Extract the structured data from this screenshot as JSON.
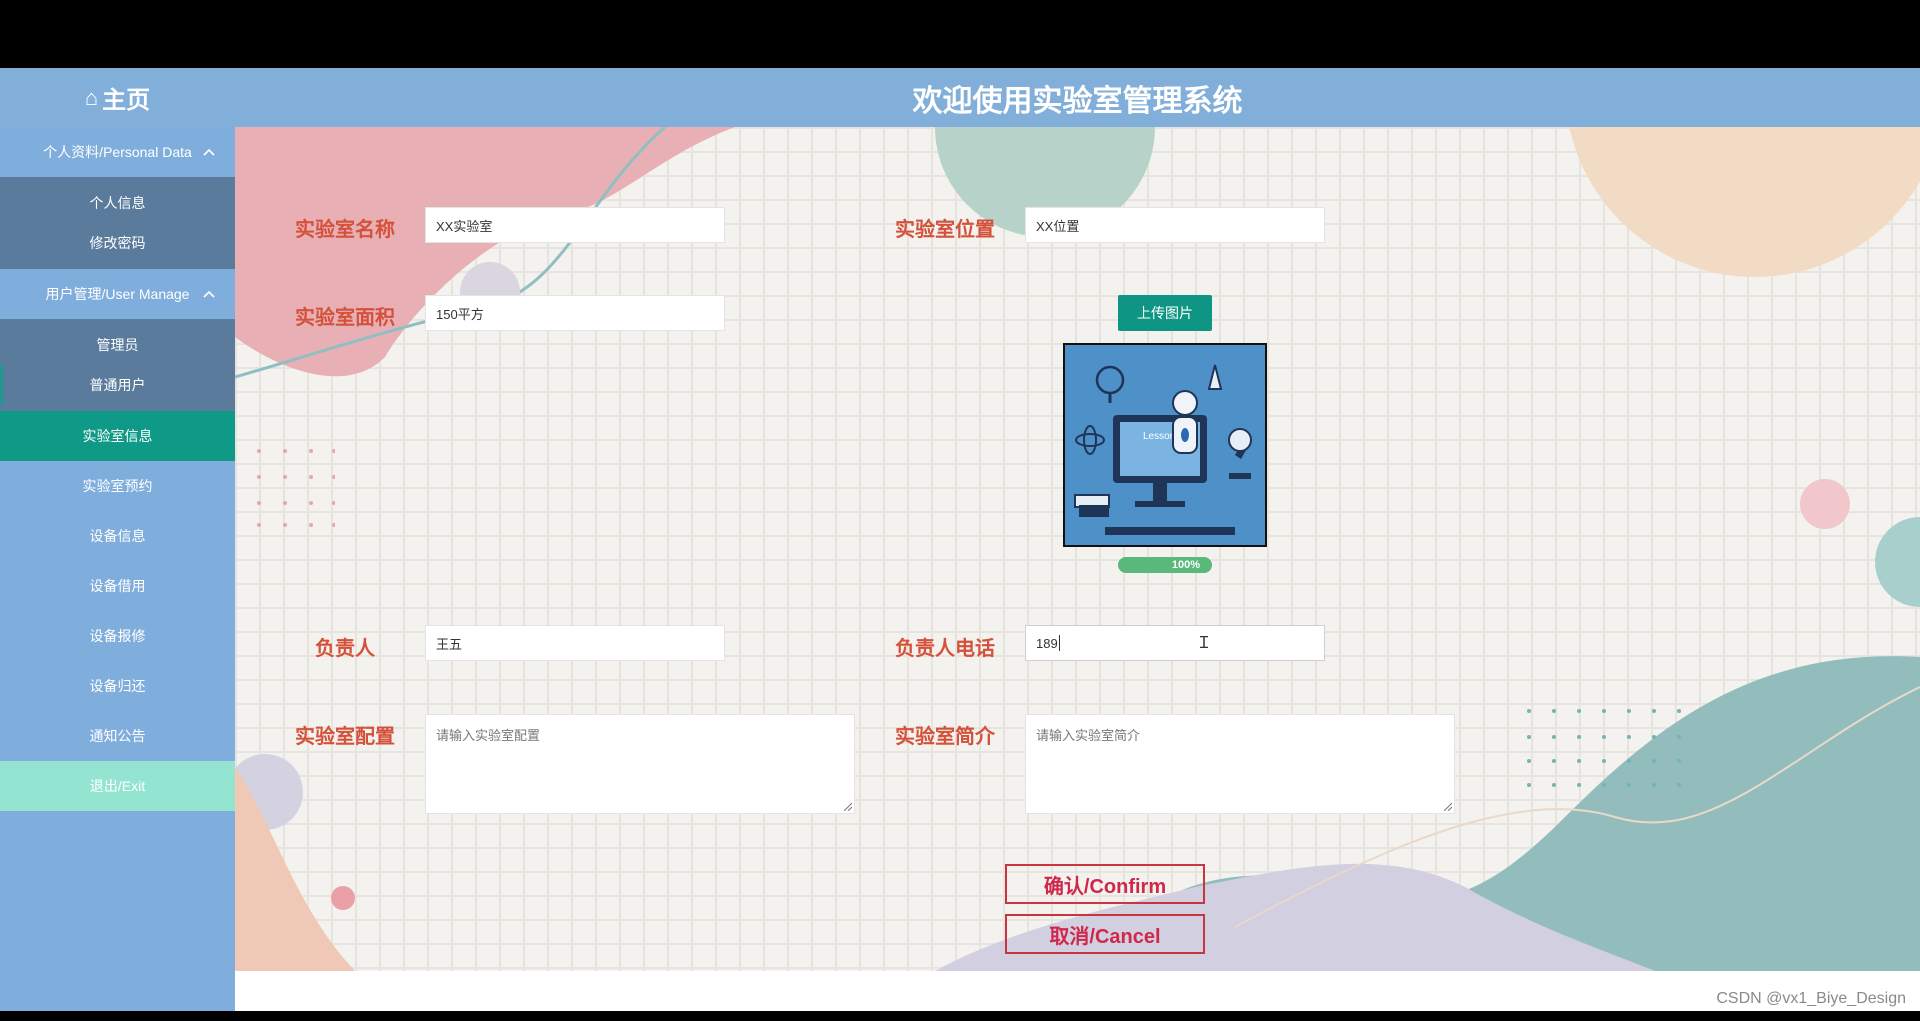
{
  "header": {
    "home_label": "主页",
    "home_icon": "home-icon",
    "title": "欢迎使用实验室管理系统"
  },
  "sidebar": {
    "groups": [
      {
        "label": "个人资料/Personal Data",
        "items": [
          {
            "label": "个人信息"
          },
          {
            "label": "修改密码"
          }
        ]
      },
      {
        "label": "用户管理/User Manage",
        "items": [
          {
            "label": "管理员"
          },
          {
            "label": "普通用户"
          }
        ]
      }
    ],
    "items": [
      {
        "label": "实验室信息"
      },
      {
        "label": "实验室预约"
      },
      {
        "label": "设备信息"
      },
      {
        "label": "设备借用"
      },
      {
        "label": "设备报修"
      },
      {
        "label": "设备归还"
      },
      {
        "label": "通知公告"
      }
    ],
    "exit_label": "退出/Exit",
    "active_color": "#0f9a87",
    "exit_color": "#93e5d1"
  },
  "form": {
    "lab_name": {
      "label": "实验室名称",
      "value": "XX实验室"
    },
    "lab_location": {
      "label": "实验室位置",
      "value": "XX位置"
    },
    "lab_area": {
      "label": "实验室面积",
      "value": "150平方"
    },
    "upload_label": "上传图片",
    "upload_progress_text": "100%",
    "upload_progress": 1.0,
    "manager": {
      "label": "负责人",
      "value": "王五"
    },
    "manager_phone": {
      "label": "负责人电话",
      "value": "189"
    },
    "lab_config": {
      "label": "实验室配置",
      "placeholder": "请输入实验室配置"
    },
    "lab_intro": {
      "label": "实验室简介",
      "placeholder": "请输入实验室简介"
    },
    "confirm_label": "确认/Confirm",
    "cancel_label": "取消/Cancel"
  },
  "image": {
    "caption": "Lesson 1"
  },
  "watermark": "CSDN @vx1_Biye_Design",
  "colors": {
    "header_bg": "#82aeda",
    "label": "#d4513b",
    "button_border": "#c8343f",
    "upload_button": "#0e9584",
    "progress": "#59b87a"
  }
}
